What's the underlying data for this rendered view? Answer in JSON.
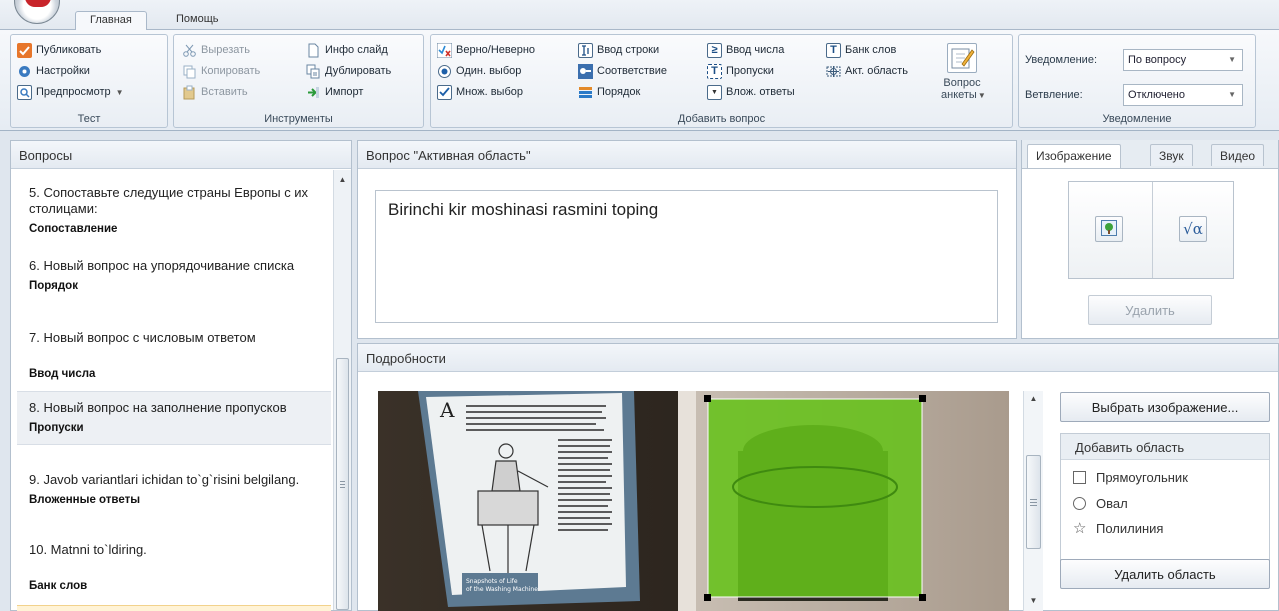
{
  "ribbon": {
    "tabs": [
      "Главная",
      "Помощь"
    ],
    "test_group": {
      "label": "Тест",
      "publish": "Публиковать",
      "settings": "Настройки",
      "preview": "Предпросмотр"
    },
    "tools_group": {
      "label": "Инструменты",
      "cut": "Вырезать",
      "copy": "Копировать",
      "paste": "Вставить",
      "info_slide": "Инфо слайд",
      "duplicate": "Дублировать",
      "import": "Импорт"
    },
    "add_question_group": {
      "label": "Добавить вопрос",
      "true_false": "Верно/Неверно",
      "single_choice": "Один. выбор",
      "multi_choice": "Множ. выбор",
      "string_input": "Ввод строки",
      "matching": "Соответствие",
      "order": "Порядок",
      "number_input": "Ввод числа",
      "gaps": "Пропуски",
      "nested_answers": "Влож. ответы",
      "word_bank": "Банк слов",
      "active_area": "Акт. область",
      "survey_line1": "Вопрос",
      "survey_line2": "анкеты"
    },
    "notify_group": {
      "label": "Уведомление",
      "notify_label": "Уведомление:",
      "notify_value": "По вопросу",
      "branch_label": "Ветвление:",
      "branch_value": "Отключено"
    }
  },
  "questions_panel": {
    "title": "Вопросы",
    "items": [
      {
        "text": "5. Сопоставьте следущие страны Европы с их столицами:",
        "type": "Сопоставление"
      },
      {
        "text": "6. Новый вопрос на упорядочивание списка",
        "type": "Порядок"
      },
      {
        "text": "7. Новый вопрос с числовым ответом",
        "type": "Ввод числа"
      },
      {
        "text": "8. Новый вопрос на заполнение пропусков",
        "type": "Пропуски"
      },
      {
        "text": "9. Javob variantlari ichidan to`g`risini belgilang.",
        "type": "Вложенные ответы"
      },
      {
        "text": "10. Matnni to`ldiring.",
        "type": "Банк слов"
      }
    ]
  },
  "question_panel": {
    "title": "Вопрос \"Активная область\"",
    "text": "Birinchi kir moshinasi rasmini toping"
  },
  "media_panel": {
    "tabs": [
      "Изображение",
      "Звук",
      "Видео"
    ],
    "delete_label": "Удалить"
  },
  "details_panel": {
    "title": "Подробности",
    "choose_image_label": "Выбрать изображение...",
    "add_area_label": "Добавить область",
    "area_options": [
      "Прямоугольник",
      "Овал",
      "Полилиния"
    ],
    "delete_area_label": "Удалить область"
  },
  "colors": {
    "hotspot": "#66c21a",
    "accent": "#2b5c9a"
  }
}
